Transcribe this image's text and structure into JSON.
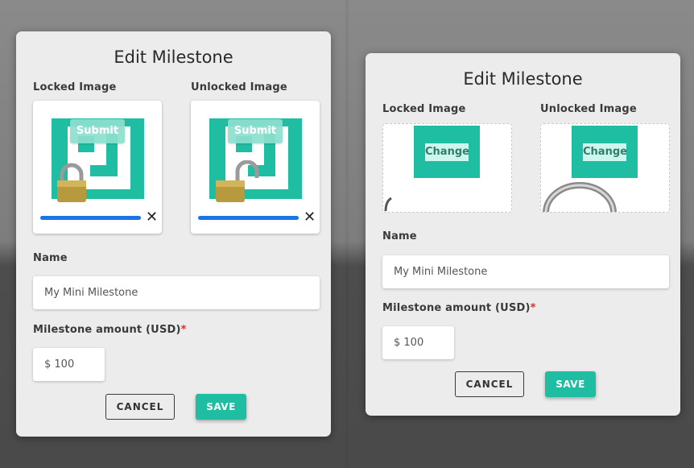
{
  "left_dialog": {
    "title": "Edit Milestone",
    "locked_label": "Locked Image",
    "unlocked_label": "Unlocked Image",
    "locked_submit": "Submit",
    "unlocked_submit": "Submit",
    "locked_upload_progress": 1.0,
    "unlocked_upload_progress": 1.0,
    "name_label": "Name",
    "name_value": "My Mini Milestone",
    "amount_label": "Milestone amount (USD)",
    "amount_required": "*",
    "amount_value": "$ 100",
    "cancel_label": "CANCEL",
    "save_label": "SAVE"
  },
  "right_dialog": {
    "title": "Edit Milestone",
    "locked_label": "Locked Image",
    "unlocked_label": "Unlocked Image",
    "locked_change": "Change",
    "unlocked_change": "Change",
    "name_label": "Name",
    "name_value": "My Mini Milestone",
    "amount_label": "Milestone amount (USD)",
    "amount_required": "*",
    "amount_value": "$ 100",
    "cancel_label": "CANCEL",
    "save_label": "SAVE"
  },
  "colors": {
    "accent": "#1fbea3",
    "progress": "#1a74e4",
    "required": "#d93025",
    "card": "#ececec"
  }
}
